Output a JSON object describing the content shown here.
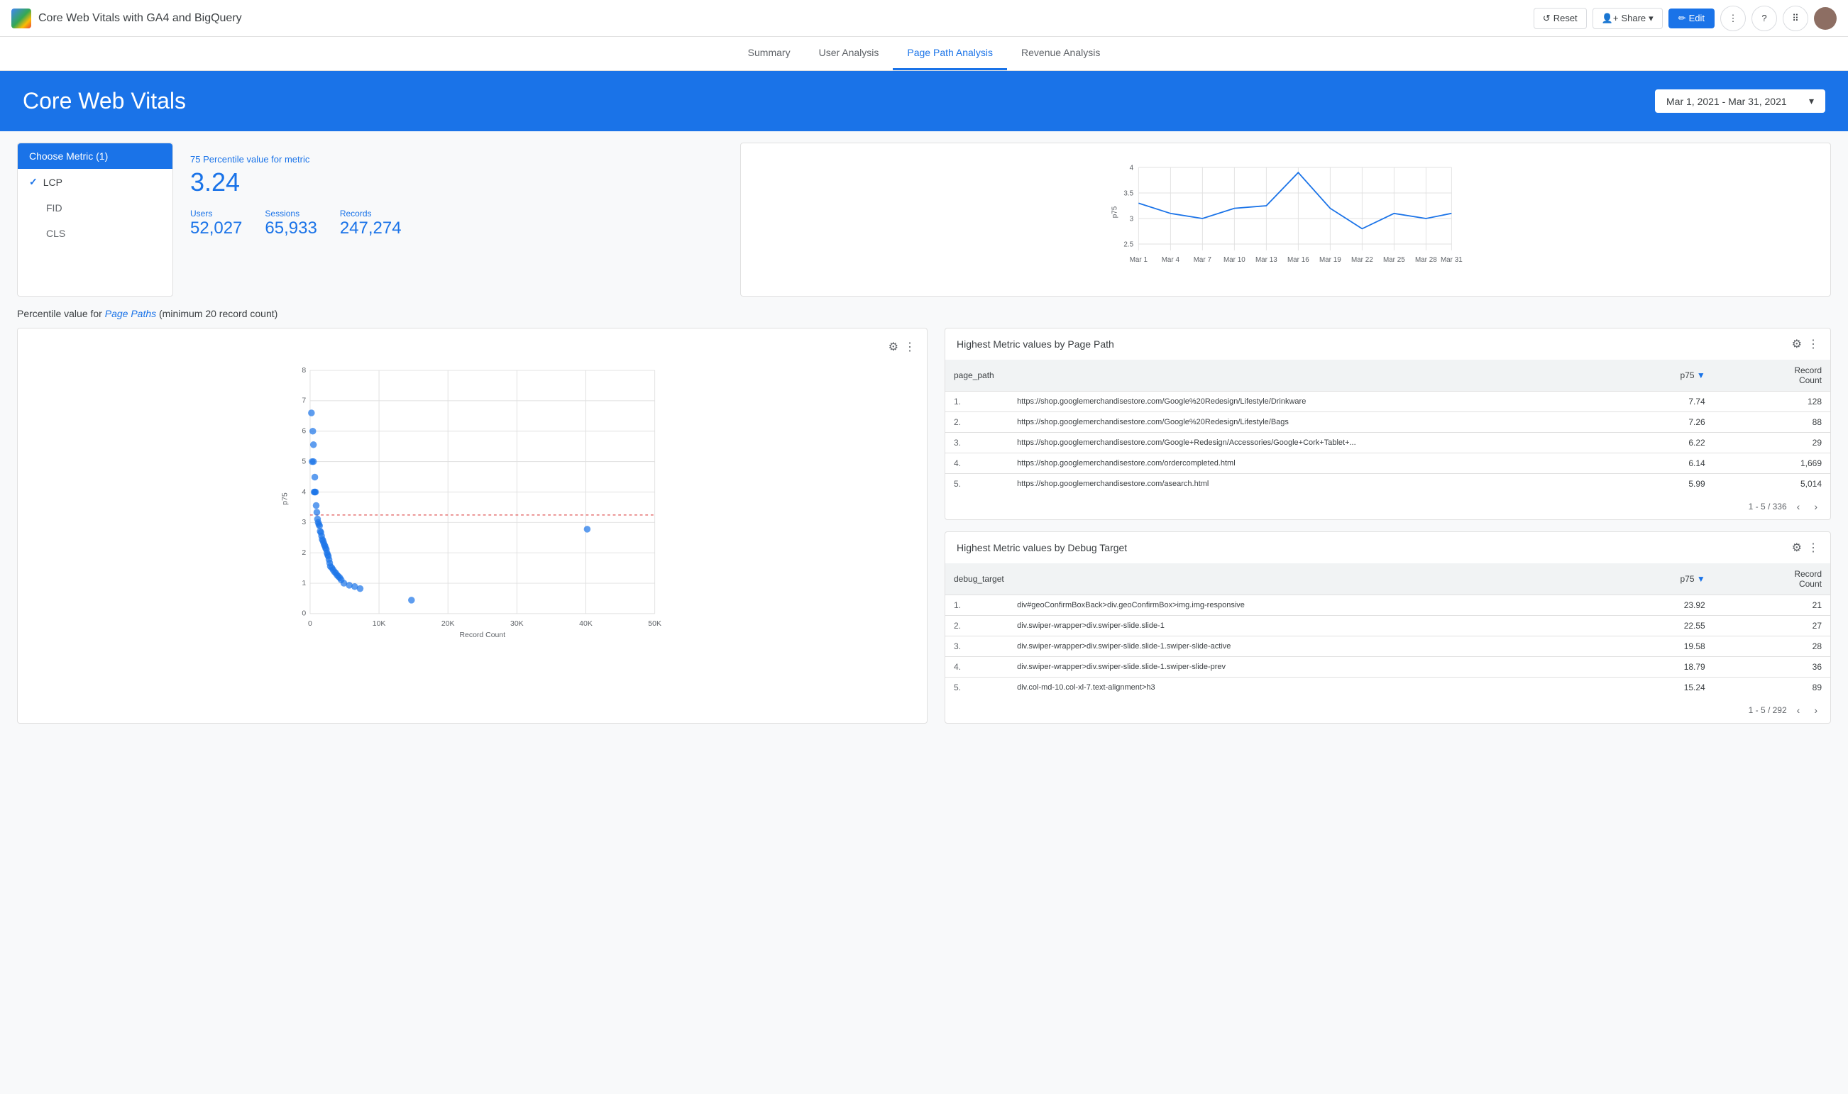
{
  "topbar": {
    "title": "Core Web Vitals with GA4 and BigQuery",
    "reset_label": "Reset",
    "share_label": "Share",
    "edit_label": "Edit"
  },
  "nav": {
    "tabs": [
      {
        "label": "Summary",
        "active": false
      },
      {
        "label": "User Analysis",
        "active": false
      },
      {
        "label": "Page Path Analysis",
        "active": true
      },
      {
        "label": "Revenue Analysis",
        "active": false
      }
    ]
  },
  "banner": {
    "title": "Core Web Vitals",
    "date_range": "Mar 1, 2021 - Mar 31, 2021"
  },
  "metric_panel": {
    "choose_label": "Choose Metric (1)",
    "metrics": [
      {
        "label": "LCP",
        "selected": true
      },
      {
        "label": "FID",
        "selected": false
      },
      {
        "label": "CLS",
        "selected": false
      }
    ]
  },
  "stats": {
    "percentile_label": "75 Percentile value for metric",
    "percentile_value": "3.24",
    "users_label": "Users",
    "users_value": "52,027",
    "sessions_label": "Sessions",
    "sessions_value": "65,933",
    "records_label": "Records",
    "records_value": "247,274"
  },
  "line_chart": {
    "x_labels": [
      "Mar 1",
      "Mar 4",
      "Mar 7",
      "Mar 10",
      "Mar 13",
      "Mar 16",
      "Mar 19",
      "Mar 22",
      "Mar 25",
      "Mar 28",
      "Mar 31"
    ],
    "y_min": 2.5,
    "y_max": 4,
    "y_labels": [
      "2.5",
      "3",
      "3.5",
      "4"
    ],
    "y_axis_label": "p75"
  },
  "scatter": {
    "title_prefix": "Percentile value for ",
    "title_highlight": "Page Paths",
    "title_suffix": " (minimum 20 record count)",
    "y_label": "p75",
    "x_label": "Record Count",
    "x_ticks": [
      "0",
      "10K",
      "20K",
      "30K",
      "40K",
      "50K"
    ],
    "y_ticks": [
      "0",
      "1",
      "2",
      "3",
      "4",
      "5",
      "6",
      "7",
      "8"
    ]
  },
  "table1": {
    "title": "Highest Metric values by Page Path",
    "col1": "page_path",
    "col2": "p75",
    "col3": "Record Count",
    "rows": [
      {
        "num": "1.",
        "path": "https://shop.googlemerchandisestore.com/Google%20Redesign/Lifestyle/Drinkware",
        "p75": "7.74",
        "count": "128"
      },
      {
        "num": "2.",
        "path": "https://shop.googlemerchandisestore.com/Google%20Redesign/Lifestyle/Bags",
        "p75": "7.26",
        "count": "88"
      },
      {
        "num": "3.",
        "path": "https://shop.googlemerchandisestore.com/Google+Redesign/Accessories/Google+Cork+Tablet+...",
        "p75": "6.22",
        "count": "29"
      },
      {
        "num": "4.",
        "path": "https://shop.googlemerchandisestore.com/ordercompleted.html",
        "p75": "6.14",
        "count": "1,669"
      },
      {
        "num": "5.",
        "path": "https://shop.googlemerchandisestore.com/asearch.html",
        "p75": "5.99",
        "count": "5,014"
      }
    ],
    "pagination": "1 - 5 / 336"
  },
  "table2": {
    "title": "Highest Metric values by Debug Target",
    "col1": "debug_target",
    "col2": "p75",
    "col3": "Record Count",
    "rows": [
      {
        "num": "1.",
        "path": "div#geoConfirmBoxBack>div.geoConfirmBox>img.img-responsive",
        "p75": "23.92",
        "count": "21"
      },
      {
        "num": "2.",
        "path": "div.swiper-wrapper>div.swiper-slide.slide-1",
        "p75": "22.55",
        "count": "27"
      },
      {
        "num": "3.",
        "path": "div.swiper-wrapper>div.swiper-slide.slide-1.swiper-slide-active",
        "p75": "19.58",
        "count": "28"
      },
      {
        "num": "4.",
        "path": "div.swiper-wrapper>div.swiper-slide.slide-1.swiper-slide-prev",
        "p75": "18.79",
        "count": "36"
      },
      {
        "num": "5.",
        "path": "div.col-md-10.col-xl-7.text-alignment>h3",
        "p75": "15.24",
        "count": "89"
      }
    ],
    "pagination": "1 - 5 / 292"
  }
}
